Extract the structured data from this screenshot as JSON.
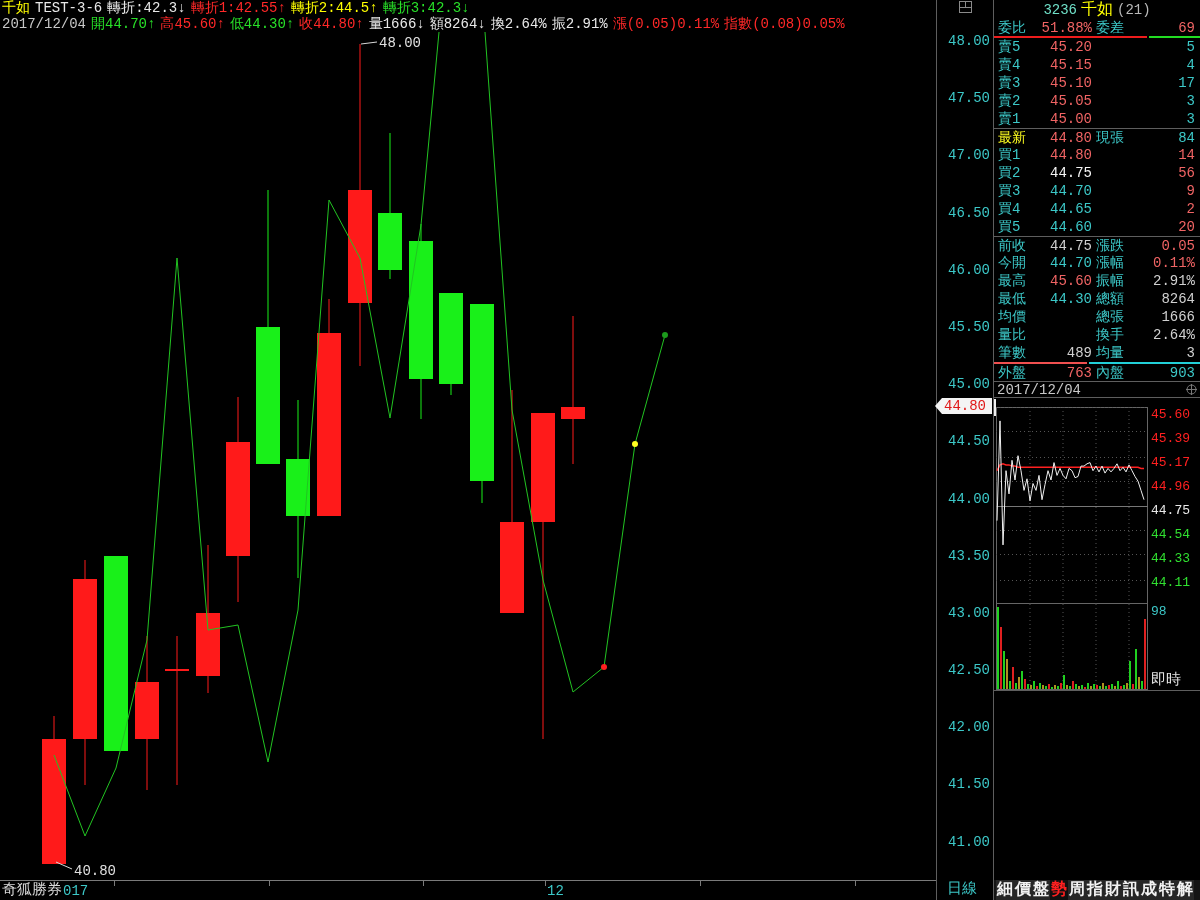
{
  "header": {
    "stock_name": "千如",
    "indicator_name": "TEST-3-6",
    "indicator_values": [
      {
        "text": "轉折:42.3↓",
        "color": "#e8e8e8"
      },
      {
        "text": "轉折1:42.55↑",
        "color": "#ff2828"
      },
      {
        "text": "轉折2:44.5↑",
        "color": "#ffff00"
      },
      {
        "text": "轉折3:42.3↓",
        "color": "#28e028"
      }
    ],
    "date": "2017/12/04",
    "quotes": [
      {
        "text": "開44.70↑",
        "color": "#28e028"
      },
      {
        "text": "高45.60↑",
        "color": "#ff2828"
      },
      {
        "text": "低44.30↑",
        "color": "#28e028"
      },
      {
        "text": "收44.80↑",
        "color": "#ff2828"
      },
      {
        "text": "量1666↓",
        "color": "#e8e8e8"
      },
      {
        "text": "額8264↓",
        "color": "#e8e8e8"
      },
      {
        "text": "換2.64%",
        "color": "#e8e8e8"
      },
      {
        "text": "振2.91%",
        "color": "#e8e8e8"
      },
      {
        "text": "漲(0.05)0.11%",
        "color": "#ff2828"
      },
      {
        "text": "指數(0.08)0.05%",
        "color": "#ff2828"
      }
    ]
  },
  "main_chart": {
    "price_axis": [
      "48.00",
      "47.50",
      "47.00",
      "46.50",
      "46.00",
      "45.50",
      "45.00",
      "44.50",
      "44.00",
      "43.50",
      "43.00",
      "42.50",
      "42.00",
      "41.50",
      "41.00"
    ],
    "high_label": "48.00",
    "low_label": "40.80",
    "last_price_tag": "44.80",
    "x_axis_labels": [
      "017",
      "12"
    ]
  },
  "quote_panel": {
    "code": "3236",
    "name": "千如",
    "count": "(21)",
    "ratio": {
      "label": "委比",
      "value": "51.88%",
      "diff_label": "委差",
      "diff_value": "69",
      "level": 0.75
    },
    "asks": [
      {
        "label": "賣5",
        "price": "45.20",
        "color": "#f06464",
        "volume": "5"
      },
      {
        "label": "賣4",
        "price": "45.15",
        "color": "#f06464",
        "volume": "4"
      },
      {
        "label": "賣3",
        "price": "45.10",
        "color": "#f06464",
        "volume": "17"
      },
      {
        "label": "賣2",
        "price": "45.05",
        "color": "#f06464",
        "volume": "3"
      },
      {
        "label": "賣1",
        "price": "45.00",
        "color": "#f06464",
        "volume": "3"
      }
    ],
    "last": {
      "label": "最新",
      "price": "44.80",
      "color": "#f06464",
      "volume_label": "現張",
      "volume": "84"
    },
    "bids": [
      {
        "label": "買1",
        "price": "44.80",
        "color": "#f06464",
        "volume": "14"
      },
      {
        "label": "買2",
        "price": "44.75",
        "color": "#f4f4f4",
        "volume": "56"
      },
      {
        "label": "買3",
        "price": "44.70",
        "color": "#3cc8c8",
        "volume": "9"
      },
      {
        "label": "買4",
        "price": "44.65",
        "color": "#3cc8c8",
        "volume": "2"
      },
      {
        "label": "買5",
        "price": "44.60",
        "color": "#3cc8c8",
        "volume": "20"
      }
    ],
    "stats": [
      [
        {
          "label": "前收",
          "value": "44.75",
          "color": "#d0d0d0"
        },
        {
          "label": "漲跌",
          "value": "0.05",
          "color": "#f06464"
        }
      ],
      [
        {
          "label": "今開",
          "value": "44.70",
          "color": "#3cc8c8"
        },
        {
          "label": "漲幅",
          "value": "0.11%",
          "color": "#f06464"
        }
      ],
      [
        {
          "label": "最高",
          "value": "45.60",
          "color": "#f06464"
        },
        {
          "label": "振幅",
          "value": "2.91%",
          "color": "#d0d0d0"
        }
      ],
      [
        {
          "label": "最低",
          "value": "44.30",
          "color": "#3cc8c8"
        },
        {
          "label": "總額",
          "value": "8264",
          "color": "#d0d0d0"
        }
      ],
      [
        {
          "label": "均價"
        },
        {
          "label": "總張",
          "value": "1666",
          "color": "#d0d0d0"
        }
      ],
      [
        {
          "label": "量比"
        },
        {
          "label": "換手",
          "value": "2.64%",
          "color": "#d0d0d0"
        }
      ],
      [
        {
          "label": "筆數",
          "value": "489",
          "color": "#d0d0d0"
        },
        {
          "label": "均量",
          "value": "3",
          "color": "#d0d0d0"
        }
      ]
    ],
    "flow": {
      "level": 0.46,
      "outer_label": "外盤",
      "outer_value": "763",
      "inner_label": "內盤",
      "inner_value": "903"
    },
    "date": "2017/12/04"
  },
  "intraday_chart": {
    "chart_data": {
      "type": "line",
      "ylim": [
        43.9,
        45.6
      ],
      "grid": true,
      "ref_lines": [
        {
          "axis": "y",
          "value": 44.75
        }
      ],
      "yticks": [
        {
          "value": 45.6,
          "label": "45.60"
        },
        {
          "value": 45.39,
          "label": "45.39"
        },
        {
          "value": 45.17,
          "label": "45.17"
        },
        {
          "value": 44.96,
          "label": "44.96"
        },
        {
          "value": 44.75,
          "label": "44.75"
        },
        {
          "value": 44.54,
          "label": "44.54"
        },
        {
          "value": 44.33,
          "label": "44.33"
        },
        {
          "value": 44.11,
          "label": "44.11"
        }
      ],
      "series": [
        {
          "color": "#f0f0f0",
          "values": [
            44.62,
            45.48,
            44.41,
            45.05,
            44.85,
            45.14,
            44.97,
            45.18,
            45.05,
            44.88,
            44.98,
            44.79,
            44.94,
            44.88,
            45.01,
            44.8,
            44.93,
            45.05,
            44.97,
            45.12,
            45.01,
            45.07,
            45.01,
            44.98,
            45.07,
            45.05,
            44.99,
            45.0,
            45.09,
            45.09,
            45.11,
            45.12,
            45.05,
            45.09,
            45.04,
            45.09,
            45.03,
            45.07,
            45.04,
            45.07,
            45.11,
            45.05,
            45.08,
            45.04,
            45.1,
            45.05,
            45.0,
            44.96,
            44.88,
            44.8
          ]
        },
        {
          "color": "#ff2020",
          "values": [
            45.05,
            45.1,
            45.11,
            45.1,
            45.1,
            45.09,
            45.09,
            45.08,
            45.08,
            45.08,
            45.08,
            45.08,
            45.08,
            45.08,
            45.08,
            45.08,
            45.08,
            45.08,
            45.08,
            45.08,
            45.08,
            45.08,
            45.08,
            45.08,
            45.08,
            45.08,
            45.08,
            45.08,
            45.08,
            45.08,
            45.08,
            45.08,
            45.08,
            45.08,
            45.08,
            45.08,
            45.08,
            45.08,
            45.08,
            45.08,
            45.08,
            45.08,
            45.08,
            45.08,
            45.08,
            45.08,
            45.08,
            45.08,
            45.07,
            45.07
          ]
        }
      ]
    },
    "tick_labels": [
      {
        "color": "#ff2020"
      },
      {
        "color": "#ff2020"
      },
      {
        "color": "#ff2020"
      },
      {
        "color": "#ff2020"
      },
      {
        "color": "#e8e8e8"
      },
      {
        "color": "#30e030"
      },
      {
        "color": "#30e030"
      },
      {
        "color": "#30e030"
      }
    ],
    "volume_max": "98",
    "mode": "即時"
  },
  "bottom_bar": {
    "app_name": "奇狐勝券",
    "period": "日線",
    "tabs": [
      {
        "label": "細",
        "selected": false
      },
      {
        "label": "價",
        "selected": false
      },
      {
        "label": "盤",
        "selected": false
      },
      {
        "label": "勢",
        "selected": true
      },
      {
        "label": "周",
        "selected": false
      },
      {
        "label": "指",
        "selected": false
      },
      {
        "label": "財",
        "selected": false
      },
      {
        "label": "訊",
        "selected": false
      },
      {
        "label": "成",
        "selected": false
      },
      {
        "label": "特",
        "selected": false
      },
      {
        "label": "解",
        "selected": false
      }
    ]
  }
}
